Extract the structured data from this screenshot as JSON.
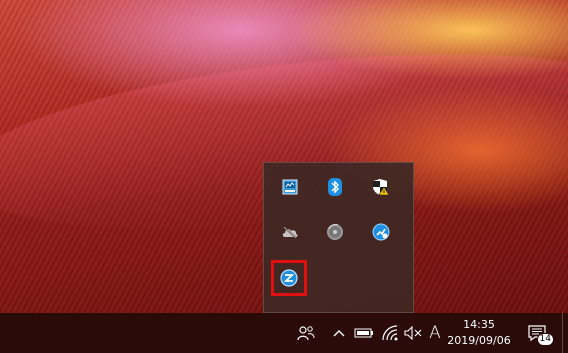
{
  "overflow_tray": {
    "icons": [
      {
        "name": "network-monitor-icon"
      },
      {
        "name": "bluetooth-icon"
      },
      {
        "name": "security-warning-icon"
      },
      {
        "name": "cloud-offline-icon"
      },
      {
        "name": "disc-icon"
      },
      {
        "name": "blue-app-icon"
      },
      {
        "name": "highlighted-app-icon",
        "highlighted": true
      }
    ]
  },
  "taskbar": {
    "language": "A",
    "clock": {
      "time": "14:35",
      "date": "2019/09/06"
    },
    "notifications": {
      "count": "14"
    }
  },
  "colors": {
    "highlight": "#e01010",
    "accent_blue": "#1e8fe1",
    "taskbar": "#2a0b0a"
  }
}
